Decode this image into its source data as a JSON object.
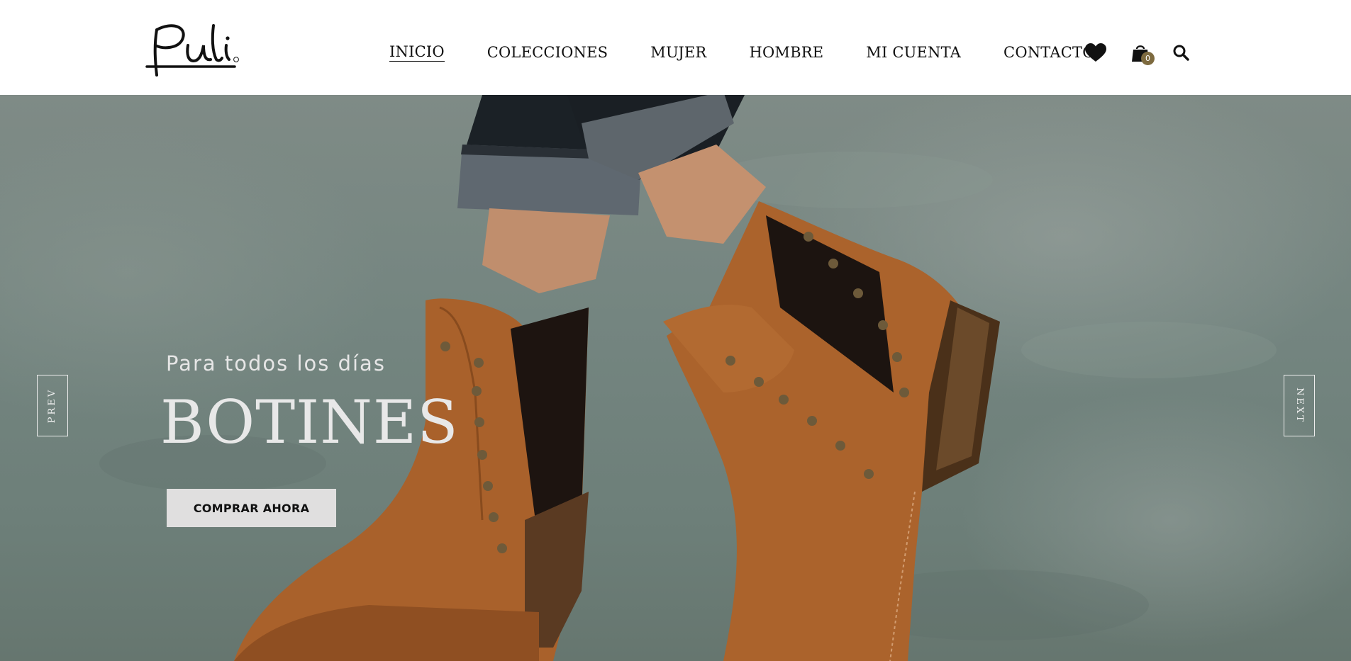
{
  "brand": {
    "logo_text": "Puli",
    "logo_mark": "®"
  },
  "nav": {
    "items": [
      {
        "label": "INICIO",
        "active": true
      },
      {
        "label": "COLECCIONES",
        "active": false
      },
      {
        "label": "MUJER",
        "active": false
      },
      {
        "label": "HOMBRE",
        "active": false
      },
      {
        "label": "MI CUENTA",
        "active": false
      },
      {
        "label": "CONTACTO",
        "active": false
      }
    ]
  },
  "header_icons": {
    "wishlist": "heart-icon",
    "cart": "shopping-bag-icon",
    "cart_count": "0",
    "search": "search-icon"
  },
  "hero": {
    "subtitle": "Para todos los días",
    "title": "BOTINES",
    "cta_label": "COMPRAR AHORA",
    "prev_label": "PREV",
    "next_label": "NEXT"
  },
  "colors": {
    "header_bg": "#ffffff",
    "nav_text": "#111111",
    "cart_badge": "#7d6a3f",
    "hero_ground": "#748580",
    "boot_leather": "#a8602a",
    "cta_bg": "#e0dfdf"
  }
}
